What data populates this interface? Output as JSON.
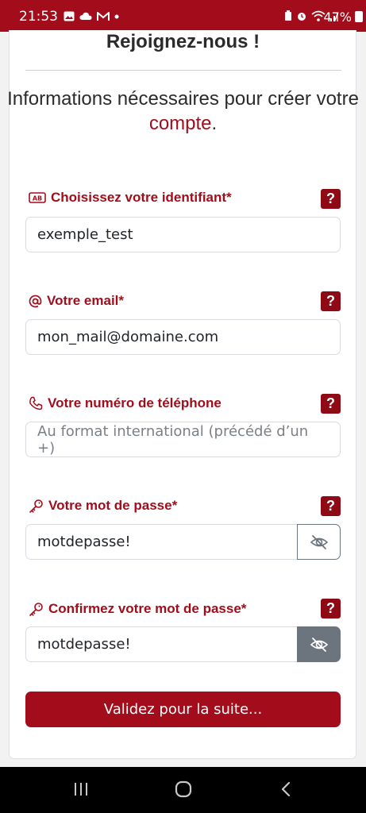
{
  "status_bar": {
    "time": "21:53",
    "battery": "47%",
    "color": "#a30d1b"
  },
  "form": {
    "title": "Rejoignez-nous !",
    "intro_prefix": "Informations nécessaires pour créer votre ",
    "intro_accent": "compte",
    "intro_suffix": ".",
    "help_label": "?",
    "fields": [
      {
        "label": "Choisissez votre identifiant*",
        "icon": "ab-badge-icon",
        "value": "exemple_test",
        "placeholder": ""
      },
      {
        "label": "Votre email*",
        "icon": "at-icon",
        "value": "mon_mail@domaine.com",
        "placeholder": ""
      },
      {
        "label": "Votre numéro de téléphone",
        "icon": "phone-icon",
        "value": "",
        "placeholder": "Au format international (précédé d’un +)"
      },
      {
        "label": "Votre mot de passe*",
        "icon": "key-icon",
        "value": "motdepasse!",
        "placeholder": ""
      },
      {
        "label": "Confirmez votre mot de passe*",
        "icon": "key-icon",
        "value": "motdepasse!",
        "placeholder": ""
      }
    ],
    "submit_label": "Validez pour la suite...",
    "accent_color": "#a30d1b"
  }
}
